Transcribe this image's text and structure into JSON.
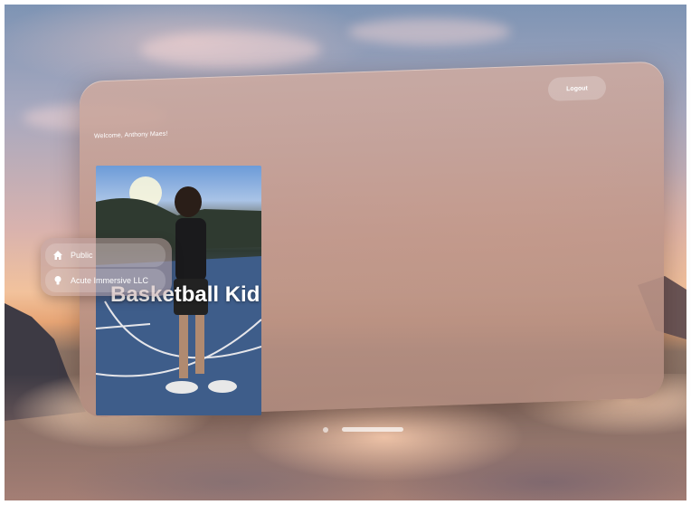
{
  "header": {
    "welcome_text": "Welcome, Anthony Maes!",
    "logout_label": "Logout"
  },
  "content": {
    "featured_title": "Basketball Kid"
  },
  "menu": {
    "items": [
      {
        "label": "Public",
        "icon": "house-icon"
      },
      {
        "label": "Acute Immersive LLC",
        "icon": "lightbulb-icon"
      }
    ]
  },
  "colors": {
    "glass": "#c8a89d",
    "text": "#ffffff"
  }
}
